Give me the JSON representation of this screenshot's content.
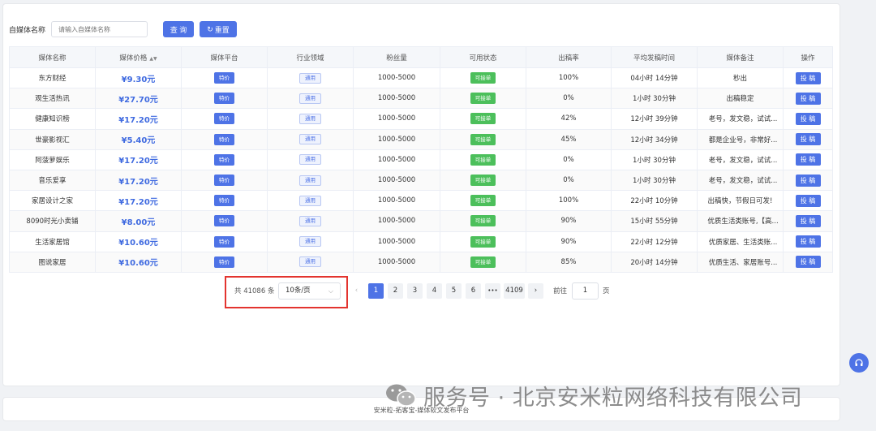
{
  "filter": {
    "label": "自媒体名称",
    "placeholder": "请输入自媒体名称",
    "query_label": "查 询",
    "reset_label": "重置"
  },
  "table": {
    "columns": [
      "媒体名称",
      "媒体价格",
      "媒体平台",
      "行业领域",
      "粉丝量",
      "可用状态",
      "出稿率",
      "平均发稿时间",
      "媒体备注",
      "操作"
    ],
    "rows": [
      {
        "name": "东方财经",
        "price": "¥9.30元",
        "platform": "特价",
        "industry": "通用",
        "fans": "1000-5000",
        "status": "可接单",
        "rate": "100%",
        "avg_time": "04小时 14分钟",
        "note": "秒出",
        "action": "投 稿"
      },
      {
        "name": "观生活热讯",
        "price": "¥27.70元",
        "platform": "特价",
        "industry": "通用",
        "fans": "1000-5000",
        "status": "可接单",
        "rate": "0%",
        "avg_time": "1小时 30分钟",
        "note": "出稿稳定",
        "action": "投 稿"
      },
      {
        "name": "健康知识榜",
        "price": "¥17.20元",
        "platform": "特价",
        "industry": "通用",
        "fans": "1000-5000",
        "status": "可接单",
        "rate": "42%",
        "avg_time": "12小时 39分钟",
        "note": "老号，发文稳，试试...",
        "action": "投 稿"
      },
      {
        "name": "世豪影视汇",
        "price": "¥5.40元",
        "platform": "特价",
        "industry": "通用",
        "fans": "1000-5000",
        "status": "可接单",
        "rate": "45%",
        "avg_time": "12小时 34分钟",
        "note": "都是企业号，非常好...",
        "action": "投 稿"
      },
      {
        "name": "阿菠萝娱乐",
        "price": "¥17.20元",
        "platform": "特价",
        "industry": "通用",
        "fans": "1000-5000",
        "status": "可接单",
        "rate": "0%",
        "avg_time": "1小时 30分钟",
        "note": "老号，发文稳，试试...",
        "action": "投 稿"
      },
      {
        "name": "音乐爱享",
        "price": "¥17.20元",
        "platform": "特价",
        "industry": "通用",
        "fans": "1000-5000",
        "status": "可接单",
        "rate": "0%",
        "avg_time": "1小时 30分钟",
        "note": "老号，发文稳，试试...",
        "action": "投 稿"
      },
      {
        "name": "家居设计之家",
        "price": "¥17.20元",
        "platform": "特价",
        "industry": "通用",
        "fans": "1000-5000",
        "status": "可接单",
        "rate": "100%",
        "avg_time": "22小时 10分钟",
        "note": "出稿快，节假日可发!",
        "action": "投 稿"
      },
      {
        "name": "8090时光小卖铺",
        "price": "¥8.00元",
        "platform": "特价",
        "industry": "通用",
        "fans": "1000-5000",
        "status": "可接单",
        "rate": "90%",
        "avg_time": "15小时 55分钟",
        "note": "优质生活类账号,【高...",
        "action": "投 稿"
      },
      {
        "name": "生活家居馆",
        "price": "¥10.60元",
        "platform": "特价",
        "industry": "通用",
        "fans": "1000-5000",
        "status": "可接单",
        "rate": "90%",
        "avg_time": "22小时 12分钟",
        "note": "优质家居、生活类账...",
        "action": "投 稿"
      },
      {
        "name": "图说家居",
        "price": "¥10.60元",
        "platform": "特价",
        "industry": "通用",
        "fans": "1000-5000",
        "status": "可接单",
        "rate": "85%",
        "avg_time": "20小时 14分钟",
        "note": "优质生活、家居账号...",
        "action": "投 稿"
      }
    ]
  },
  "pagination": {
    "total_text": "共 41086 条",
    "page_size": "10条/页",
    "pages": [
      "1",
      "2",
      "3",
      "4",
      "5",
      "6",
      "•••",
      "4109"
    ],
    "current_page": "1",
    "goto_label": "前往",
    "goto_value": "1",
    "page_suffix": "页"
  },
  "footer": {
    "text": "安米粒-拓客宝-媒体软文发布平台"
  },
  "watermark": {
    "text": "服务号 · 北京安米粒网络科技有限公司"
  },
  "icons": {
    "reset": "refresh-icon",
    "sort": "sort-icon",
    "prev": "chevron-left-icon",
    "next": "chevron-right-icon",
    "caret": "chevron-down-icon",
    "support": "headset-icon",
    "wechat": "wechat-logo-icon"
  },
  "colors": {
    "primary": "#4e73e6",
    "success": "#4cbf5b",
    "price": "#3f6ae0",
    "highlight": "#e3342f"
  }
}
